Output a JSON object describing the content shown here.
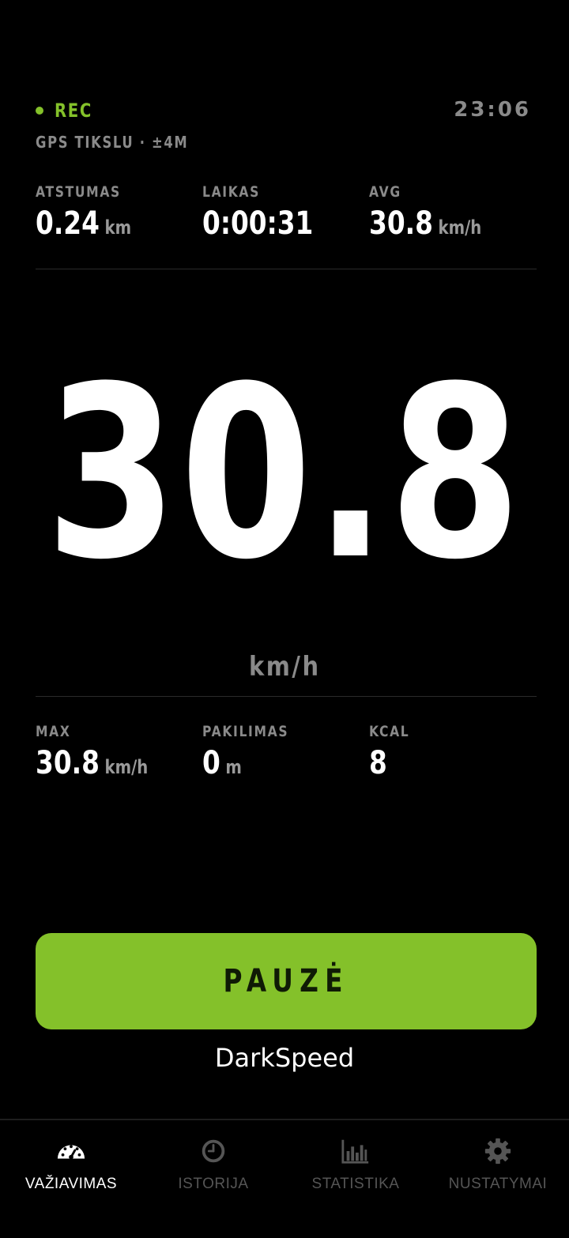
{
  "header": {
    "rec_label": "REC",
    "clock": "23:06",
    "gps": "GPS TIKSLU · ±4M"
  },
  "top_stats": [
    {
      "label": "ATSTUMAS",
      "value": "0.24",
      "unit": "km"
    },
    {
      "label": "LAIKAS",
      "value": "0:00:31",
      "unit": ""
    },
    {
      "label": "AVG",
      "value": "30.8",
      "unit": "km/h"
    }
  ],
  "speed": {
    "value": "30.8",
    "unit": "km/h"
  },
  "bottom_stats": [
    {
      "label": "MAX",
      "value": "30.8",
      "unit": "km/h"
    },
    {
      "label": "PAKILIMAS",
      "value": "0",
      "unit": "m"
    },
    {
      "label": "KCAL",
      "value": "8",
      "unit": ""
    }
  ],
  "pause_button": {
    "label": "PAUZĖ"
  },
  "brand": "DarkSpeed",
  "nav": [
    {
      "label": "VAŽIAVIMAS",
      "icon": "speedometer-icon",
      "active": true
    },
    {
      "label": "ISTORIJA",
      "icon": "clock-icon",
      "active": false
    },
    {
      "label": "STATISTIKA",
      "icon": "bar-chart-icon",
      "active": false
    },
    {
      "label": "NUSTATYMAI",
      "icon": "gear-icon",
      "active": false
    }
  ],
  "colors": {
    "accent": "#84c12a",
    "background": "#000000",
    "muted": "#8a8a8a",
    "nav_inactive": "#555555"
  }
}
